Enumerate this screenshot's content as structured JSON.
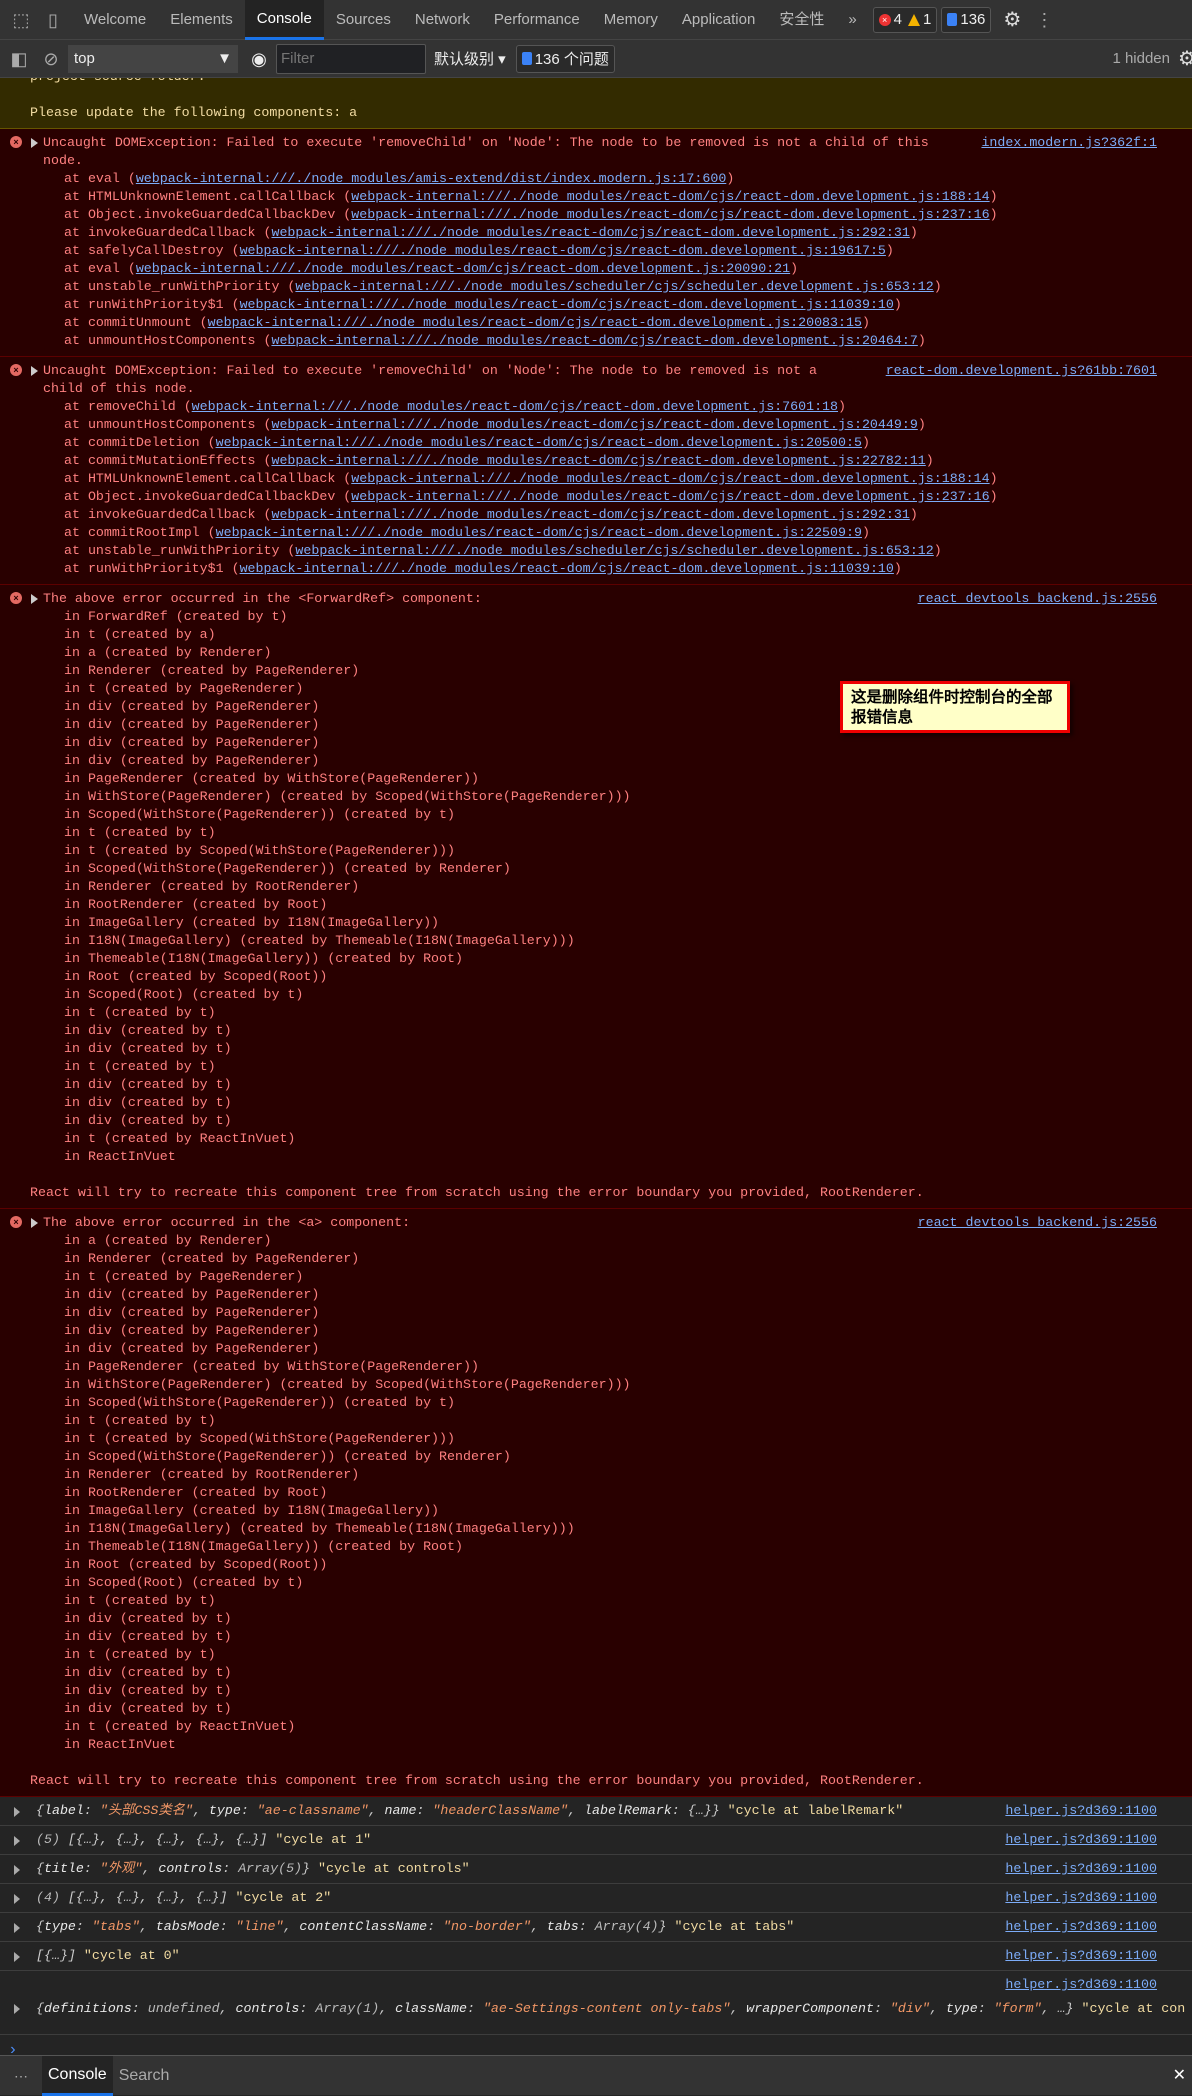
{
  "tabs": [
    "Welcome",
    "Elements",
    "Console",
    "Sources",
    "Network",
    "Performance",
    "Memory",
    "Application",
    "安全性"
  ],
  "active_tab": "Console",
  "more_tabs": "»",
  "badges": {
    "errors": "4",
    "warnings": "1",
    "issues": "136"
  },
  "toolbar": {
    "context": "top",
    "filter_placeholder": "Filter",
    "level": "默认级别",
    "issues_btn": "136 个问题",
    "hidden": "1 hidden"
  },
  "warning": {
    "lines": [
      "project source folder.",
      "",
      "Please update the following components: a"
    ]
  },
  "errors": [
    {
      "source": "index.modern.js?362f:1",
      "lines": [
        "Uncaught DOMException: Failed to execute 'removeChild' on 'Node': The node to be removed is not a child of this",
        "node."
      ],
      "stack": [
        [
          "at eval (",
          "webpack-internal:///./node_modules/amis-extend/dist/index.modern.js:17:600",
          ")"
        ],
        [
          "at HTMLUnknownElement.callCallback (",
          "webpack-internal:///./node_modules/react-dom/cjs/react-dom.development.js:188:14",
          ")"
        ],
        [
          "at Object.invokeGuardedCallbackDev (",
          "webpack-internal:///./node_modules/react-dom/cjs/react-dom.development.js:237:16",
          ")"
        ],
        [
          "at invokeGuardedCallback (",
          "webpack-internal:///./node_modules/react-dom/cjs/react-dom.development.js:292:31",
          ")"
        ],
        [
          "at safelyCallDestroy (",
          "webpack-internal:///./node_modules/react-dom/cjs/react-dom.development.js:19617:5",
          ")"
        ],
        [
          "at eval (",
          "webpack-internal:///./node_modules/react-dom/cjs/react-dom.development.js:20090:21",
          ")"
        ],
        [
          "at unstable_runWithPriority (",
          "webpack-internal:///./node_modules/scheduler/cjs/scheduler.development.js:653:12",
          ")"
        ],
        [
          "at runWithPriority$1 (",
          "webpack-internal:///./node_modules/react-dom/cjs/react-dom.development.js:11039:10",
          ")"
        ],
        [
          "at commitUnmount (",
          "webpack-internal:///./node_modules/react-dom/cjs/react-dom.development.js:20083:15",
          ")"
        ],
        [
          "at unmountHostComponents (",
          "webpack-internal:///./node_modules/react-dom/cjs/react-dom.development.js:20464:7",
          ")"
        ]
      ]
    },
    {
      "source": "react-dom.development.js?61bb:7601",
      "lines": [
        "Uncaught DOMException: Failed to execute 'removeChild' on 'Node': The node to be removed is not a",
        "child of this node."
      ],
      "stack": [
        [
          "at removeChild (",
          "webpack-internal:///./node_modules/react-dom/cjs/react-dom.development.js:7601:18",
          ")"
        ],
        [
          "at unmountHostComponents (",
          "webpack-internal:///./node_modules/react-dom/cjs/react-dom.development.js:20449:9",
          ")"
        ],
        [
          "at commitDeletion (",
          "webpack-internal:///./node_modules/react-dom/cjs/react-dom.development.js:20500:5",
          ")"
        ],
        [
          "at commitMutationEffects (",
          "webpack-internal:///./node_modules/react-dom/cjs/react-dom.development.js:22782:11",
          ")"
        ],
        [
          "at HTMLUnknownElement.callCallback (",
          "webpack-internal:///./node_modules/react-dom/cjs/react-dom.development.js:188:14",
          ")"
        ],
        [
          "at Object.invokeGuardedCallbackDev (",
          "webpack-internal:///./node_modules/react-dom/cjs/react-dom.development.js:237:16",
          ")"
        ],
        [
          "at invokeGuardedCallback (",
          "webpack-internal:///./node_modules/react-dom/cjs/react-dom.development.js:292:31",
          ")"
        ],
        [
          "at commitRootImpl (",
          "webpack-internal:///./node_modules/react-dom/cjs/react-dom.development.js:22509:9",
          ")"
        ],
        [
          "at unstable_runWithPriority (",
          "webpack-internal:///./node_modules/scheduler/cjs/scheduler.development.js:653:12",
          ")"
        ],
        [
          "at runWithPriority$1 (",
          "webpack-internal:///./node_modules/react-dom/cjs/react-dom.development.js:11039:10",
          ")"
        ]
      ]
    },
    {
      "source": "react_devtools_backend.js:2556",
      "lines": [
        "The above error occurred in the <ForwardRef> component:"
      ],
      "tree": [
        "in ForwardRef (created by t)",
        "in t (created by a)",
        "in a (created by Renderer)",
        "in Renderer (created by PageRenderer)",
        "in t (created by PageRenderer)",
        "in div (created by PageRenderer)",
        "in div (created by PageRenderer)",
        "in div (created by PageRenderer)",
        "in div (created by PageRenderer)",
        "in PageRenderer (created by WithStore(PageRenderer))",
        "in WithStore(PageRenderer) (created by Scoped(WithStore(PageRenderer)))",
        "in Scoped(WithStore(PageRenderer)) (created by t)",
        "in t (created by t)",
        "in t (created by Scoped(WithStore(PageRenderer)))",
        "in Scoped(WithStore(PageRenderer)) (created by Renderer)",
        "in Renderer (created by RootRenderer)",
        "in RootRenderer (created by Root)",
        "in ImageGallery (created by I18N(ImageGallery))",
        "in I18N(ImageGallery) (created by Themeable(I18N(ImageGallery)))",
        "in Themeable(I18N(ImageGallery)) (created by Root)",
        "in Root (created by Scoped(Root))",
        "in Scoped(Root) (created by t)",
        "in t (created by t)",
        "in div (created by t)",
        "in div (created by t)",
        "in t (created by t)",
        "in div (created by t)",
        "in div (created by t)",
        "in div (created by t)",
        "in t (created by ReactInVuet)",
        "in ReactInVuet"
      ],
      "footer": "React will try to recreate this component tree from scratch using the error boundary you provided, RootRenderer."
    },
    {
      "source": "react_devtools_backend.js:2556",
      "lines": [
        "The above error occurred in the <a> component:"
      ],
      "tree": [
        "in a (created by Renderer)",
        "in Renderer (created by PageRenderer)",
        "in t (created by PageRenderer)",
        "in div (created by PageRenderer)",
        "in div (created by PageRenderer)",
        "in div (created by PageRenderer)",
        "in div (created by PageRenderer)",
        "in PageRenderer (created by WithStore(PageRenderer))",
        "in WithStore(PageRenderer) (created by Scoped(WithStore(PageRenderer)))",
        "in Scoped(WithStore(PageRenderer)) (created by t)",
        "in t (created by t)",
        "in t (created by Scoped(WithStore(PageRenderer)))",
        "in Scoped(WithStore(PageRenderer)) (created by Renderer)",
        "in Renderer (created by RootRenderer)",
        "in RootRenderer (created by Root)",
        "in ImageGallery (created by I18N(ImageGallery))",
        "in I18N(ImageGallery) (created by Themeable(I18N(ImageGallery)))",
        "in Themeable(I18N(ImageGallery)) (created by Root)",
        "in Root (created by Scoped(Root))",
        "in Scoped(Root) (created by t)",
        "in t (created by t)",
        "in div (created by t)",
        "in div (created by t)",
        "in t (created by t)",
        "in div (created by t)",
        "in div (created by t)",
        "in div (created by t)",
        "in t (created by ReactInVuet)",
        "in ReactInVuet"
      ],
      "footer": "React will try to recreate this component tree from scratch using the error boundary you provided, RootRenderer."
    }
  ],
  "logs": [
    {
      "source": "helper.js?d369:1100",
      "segs": [
        [
          "p",
          "{"
        ],
        [
          "k",
          "label"
        ],
        [
          "p",
          ": "
        ],
        [
          "s",
          "\"头部CSS类名\""
        ],
        [
          "p",
          ", "
        ],
        [
          "k",
          "type"
        ],
        [
          "p",
          ": "
        ],
        [
          "s",
          "\"ae-classname\""
        ],
        [
          "p",
          ", "
        ],
        [
          "k",
          "name"
        ],
        [
          "p",
          ": "
        ],
        [
          "s",
          "\"headerClassName\""
        ],
        [
          "p",
          ", "
        ],
        [
          "k",
          "labelRemark"
        ],
        [
          "p",
          ": {…}}"
        ],
        [
          "m",
          " \"cycle at labelRemark\""
        ]
      ]
    },
    {
      "source": "helper.js?d369:1100",
      "segs": [
        [
          "v",
          "(5) "
        ],
        [
          "p",
          "[{…}, {…}, {…}, {…}, {…}]"
        ],
        [
          "m",
          " \"cycle at 1\""
        ]
      ]
    },
    {
      "source": "helper.js?d369:1100",
      "segs": [
        [
          "p",
          "{"
        ],
        [
          "k",
          "title"
        ],
        [
          "p",
          ": "
        ],
        [
          "s",
          "\"外观\""
        ],
        [
          "p",
          ", "
        ],
        [
          "k",
          "controls"
        ],
        [
          "p",
          ": "
        ],
        [
          "v",
          "Array(5)"
        ],
        [
          "p",
          "}"
        ],
        [
          "m",
          " \"cycle at controls\""
        ]
      ]
    },
    {
      "source": "helper.js?d369:1100",
      "segs": [
        [
          "v",
          "(4) "
        ],
        [
          "p",
          "[{…}, {…}, {…}, {…}]"
        ],
        [
          "m",
          " \"cycle at 2\""
        ]
      ]
    },
    {
      "source": "helper.js?d369:1100",
      "segs": [
        [
          "p",
          "{"
        ],
        [
          "k",
          "type"
        ],
        [
          "p",
          ": "
        ],
        [
          "s",
          "\"tabs\""
        ],
        [
          "p",
          ", "
        ],
        [
          "k",
          "tabsMode"
        ],
        [
          "p",
          ": "
        ],
        [
          "s",
          "\"line\""
        ],
        [
          "p",
          ", "
        ],
        [
          "k",
          "contentClassName"
        ],
        [
          "p",
          ": "
        ],
        [
          "s",
          "\"no-border\""
        ],
        [
          "p",
          ", "
        ],
        [
          "k",
          "tabs"
        ],
        [
          "p",
          ": "
        ],
        [
          "v",
          "Array(4)"
        ],
        [
          "p",
          "}"
        ],
        [
          "m",
          " \"cycle at tabs\""
        ]
      ]
    },
    {
      "source": "helper.js?d369:1100",
      "segs": [
        [
          "p",
          "[{…}]"
        ],
        [
          "m",
          " \"cycle at 0\""
        ]
      ]
    },
    {
      "source": "helper.js?d369:1100",
      "tall": true,
      "segs": [
        [
          "p",
          "{"
        ],
        [
          "k",
          "definitions"
        ],
        [
          "p",
          ": "
        ],
        [
          "v",
          "undefined"
        ],
        [
          "p",
          ", "
        ],
        [
          "k",
          "controls"
        ],
        [
          "p",
          ": "
        ],
        [
          "v",
          "Array(1)"
        ],
        [
          "p",
          ", "
        ],
        [
          "k",
          "className"
        ],
        [
          "p",
          ": "
        ],
        [
          "s",
          "\"ae-Settings-content only-tabs\""
        ],
        [
          "p",
          ", "
        ],
        [
          "k",
          "wrapperComponent"
        ],
        [
          "p",
          ": "
        ],
        [
          "s",
          "\"div\""
        ],
        [
          "p",
          ", "
        ],
        [
          "k",
          "type"
        ],
        [
          "p",
          ": "
        ],
        [
          "s",
          "\"form\""
        ],
        [
          "p",
          ", …}"
        ],
        [
          "m",
          " \"cycle at controls\""
        ]
      ]
    }
  ],
  "prompt": "›",
  "annotation": "这是删除组件时控制台的全部报错信息",
  "drawer": {
    "more": "⋯",
    "tabs": [
      "Console",
      "Search"
    ],
    "close": "✕"
  }
}
